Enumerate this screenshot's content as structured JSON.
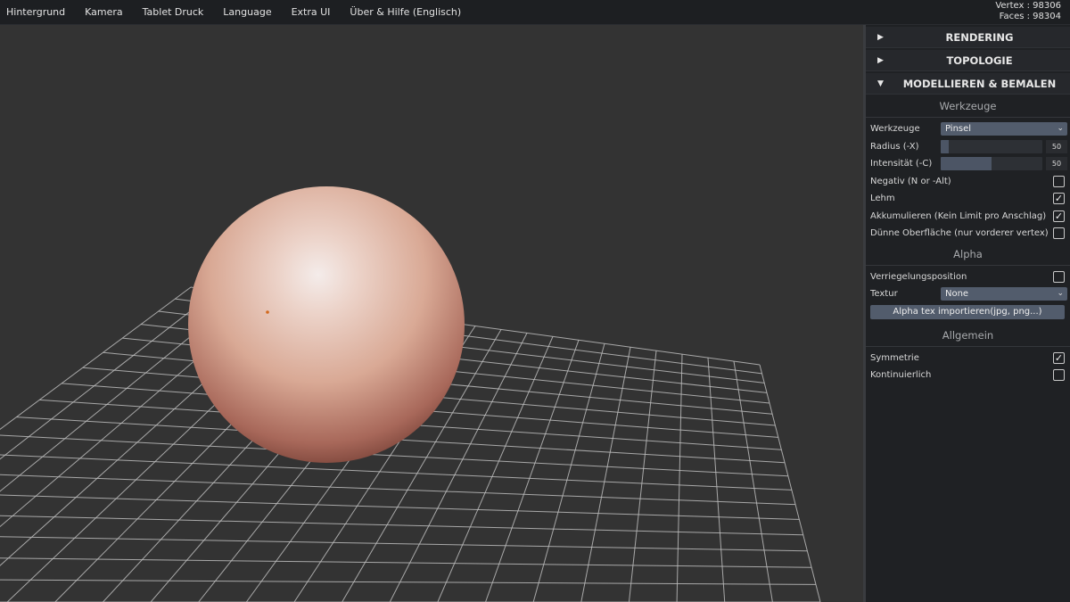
{
  "menu": {
    "items": [
      {
        "label": "Hintergrund"
      },
      {
        "label": "Kamera"
      },
      {
        "label": "Tablet Druck"
      },
      {
        "label": "Language"
      },
      {
        "label": "Extra UI"
      },
      {
        "label": "Über & Hilfe (Englisch)"
      }
    ]
  },
  "stats": {
    "vertex": "Vertex : 98306",
    "faces": "Faces : 98304"
  },
  "panel": {
    "sections": {
      "rendering": {
        "label": "RENDERING",
        "arrow": "▶"
      },
      "topology": {
        "label": "TOPOLOGIE",
        "arrow": "▶"
      },
      "sculpt": {
        "label": "MODELLIEREN & BEMALEN",
        "arrow": "▼"
      }
    },
    "tools": {
      "title": "Werkzeuge",
      "tool_label": "Werkzeuge",
      "tool_value": "Pinsel",
      "radius_label": "Radius (-X)",
      "radius_value": "50",
      "radius_fraction": 0.08,
      "intensity_label": "Intensität (-C)",
      "intensity_value": "50",
      "intensity_fraction": 0.5,
      "negative_label": "Negativ (N or -Alt)",
      "negative_checked": false,
      "clay_label": "Lehm",
      "clay_checked": true,
      "accumulate_label": "Akkumulieren (Kein Limit pro Anschlag)",
      "accumulate_checked": true,
      "thin_label": "Dünne Oberfläche (nur vorderer vertex)",
      "thin_checked": false
    },
    "alpha": {
      "title": "Alpha",
      "lock_label": "Verriegelungsposition",
      "lock_checked": false,
      "texture_label": "Textur",
      "texture_value": "None",
      "import_label": "Alpha tex importieren(jpg, png...)"
    },
    "general": {
      "title": "Allgemein",
      "symmetry_label": "Symmetrie",
      "symmetry_checked": true,
      "continuous_label": "Kontinuierlich",
      "continuous_checked": false
    }
  },
  "icons": {
    "check": "✓",
    "chevron": "⌄"
  },
  "colors": {
    "background": "#333333",
    "menubar": "#1d1f22",
    "panel": "#1f2124",
    "grid": "#bdbdbd",
    "control": "#525c6c",
    "sphere_light": "#f3e6e2",
    "sphere_mid": "#d49d88",
    "sphere_dark": "#5e2b22",
    "cursor_dot": "#d2691e"
  }
}
